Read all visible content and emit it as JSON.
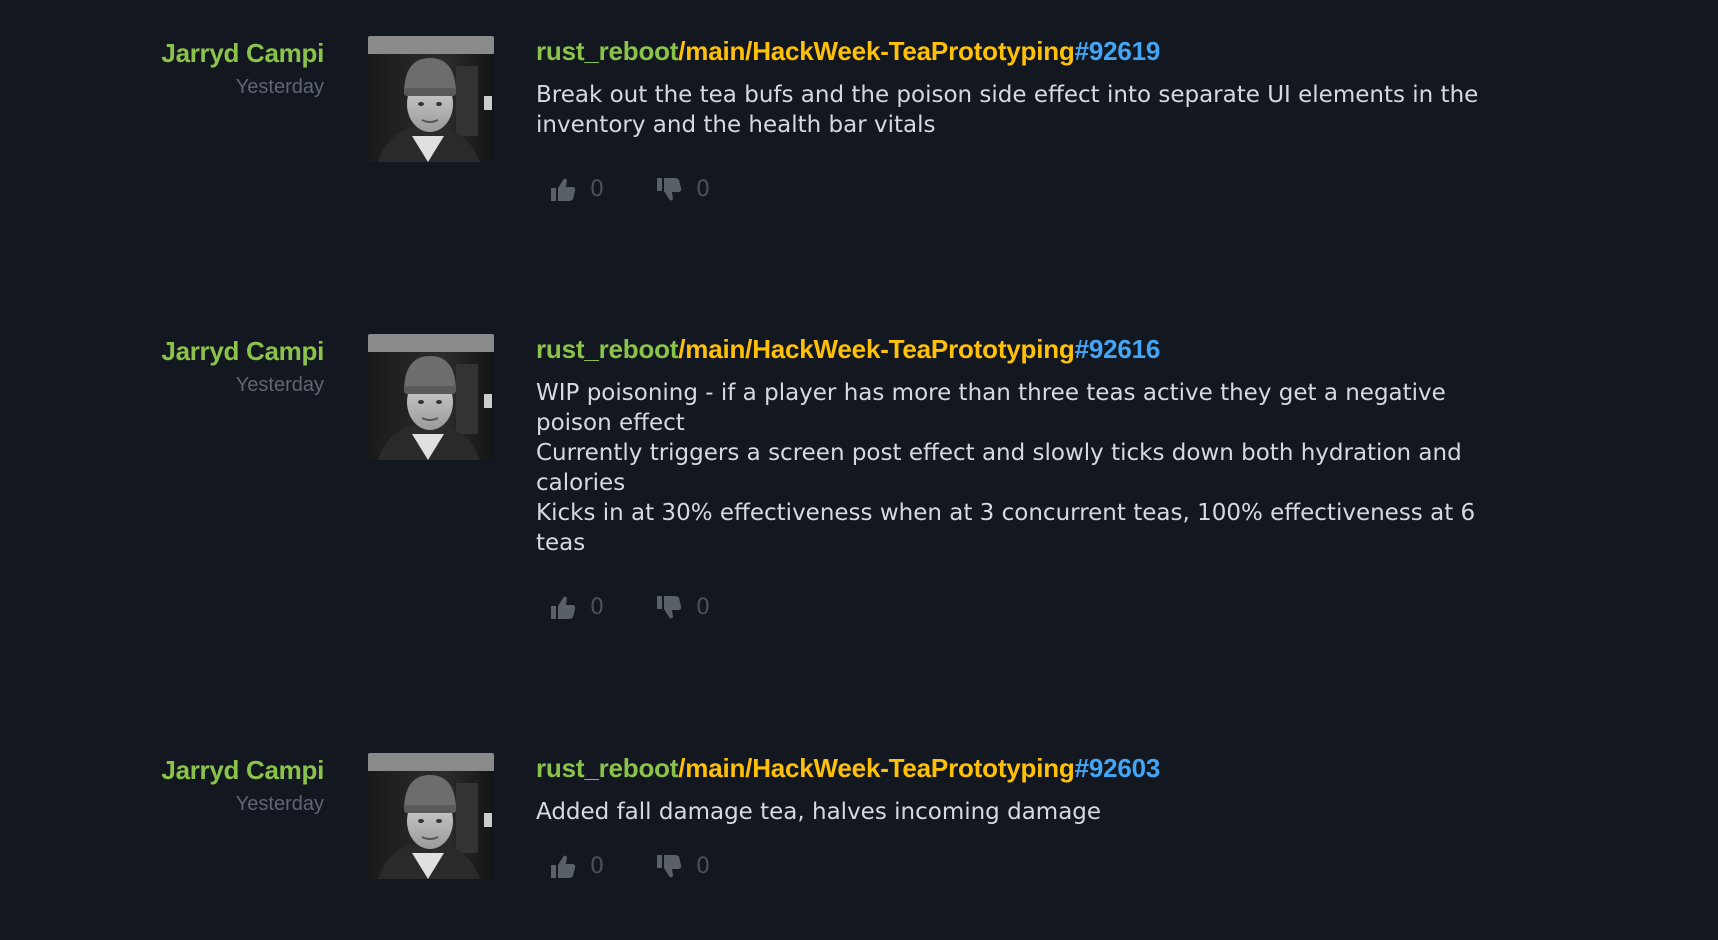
{
  "colors": {
    "background": "#121720",
    "author": "#8bc34a",
    "repo": "#8bc34a",
    "branch": "#ffc107",
    "changeset": "#42a5f5",
    "message": "#d6dae0",
    "muted": "#5f6670"
  },
  "icons": {
    "avatar": "user-photo-avatar",
    "like": "thumbs-up-icon",
    "dislike": "thumbs-down-icon"
  },
  "commits": [
    {
      "author": "Jarryd Campi",
      "date": "Yesterday",
      "repo": "rust_reboot",
      "branch": "/main/HackWeek-TeaPrototyping",
      "changeset": "#92619",
      "message": "Break out the tea bufs and the poison side effect into separate UI elements in the inventory and the health bar vitals",
      "likes": "0",
      "dislikes": "0"
    },
    {
      "author": "Jarryd Campi",
      "date": "Yesterday",
      "repo": "rust_reboot",
      "branch": "/main/HackWeek-TeaPrototyping",
      "changeset": "#92616",
      "message": "WIP poisoning - if a player has more than three teas active they get a negative poison effect\nCurrently triggers a screen post effect and slowly ticks down both hydration and calories\nKicks in at 30% effectiveness when at 3 concurrent teas, 100% effectiveness at 6 teas",
      "likes": "0",
      "dislikes": "0"
    },
    {
      "author": "Jarryd Campi",
      "date": "Yesterday",
      "repo": "rust_reboot",
      "branch": "/main/HackWeek-TeaPrototyping",
      "changeset": "#92603",
      "message": "Added fall damage tea, halves incoming damage",
      "likes": "0",
      "dislikes": "0"
    }
  ]
}
